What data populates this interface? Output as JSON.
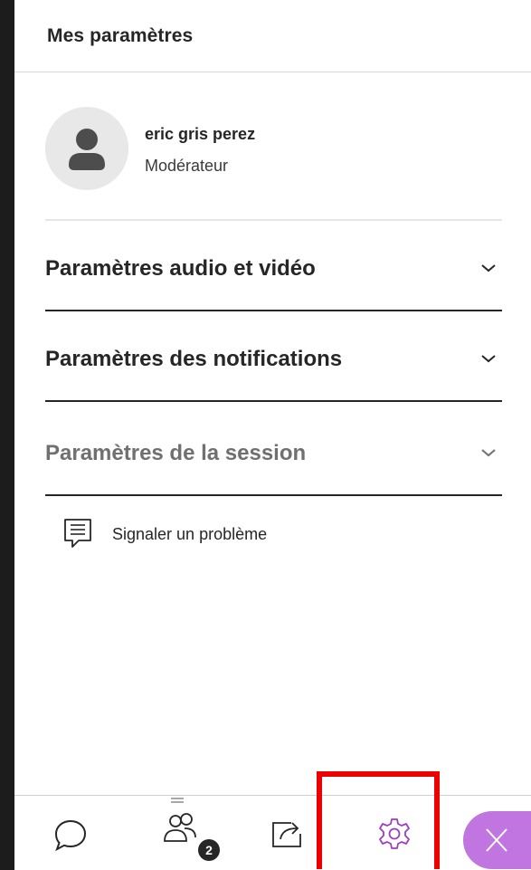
{
  "header": {
    "title": "Mes paramètres"
  },
  "profile": {
    "avatar_icon": "user-avatar-icon",
    "name": "eric gris perez",
    "role": "Modérateur"
  },
  "sections": [
    {
      "label": "Paramètres audio et vidéo",
      "state": "collapsed",
      "icon": "chevron-down-icon"
    },
    {
      "label": "Paramètres des notifications",
      "state": "collapsed",
      "icon": "chevron-down-icon"
    },
    {
      "label": "Paramètres de la session",
      "state": "collapsed",
      "muted": true,
      "icon": "chevron-down-icon"
    }
  ],
  "report": {
    "label": "Signaler un problème",
    "icon": "report-problem-icon"
  },
  "bottom_bar": {
    "tabs": [
      {
        "name": "chat",
        "icon": "chat-bubble-icon"
      },
      {
        "name": "participants",
        "icon": "participants-icon",
        "badge": "2"
      },
      {
        "name": "share-content",
        "icon": "share-icon"
      },
      {
        "name": "settings",
        "icon": "gear-icon",
        "active": true,
        "highlighted": true
      }
    ],
    "close": {
      "icon": "close-icon"
    }
  },
  "colors": {
    "highlight": "#ee0000",
    "accent": "#c175e0",
    "settings_icon": "#9b3fc2",
    "text": "#262626",
    "muted_text": "#707070"
  }
}
